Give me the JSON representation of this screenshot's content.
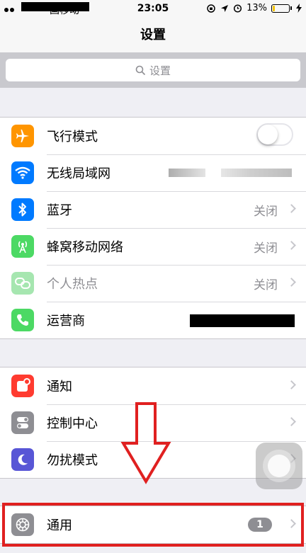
{
  "status_bar": {
    "carrier": "国移动",
    "time": "23:05",
    "battery_percent": "13%",
    "battery_level": 0.13
  },
  "nav": {
    "title": "设置"
  },
  "search": {
    "placeholder": "设置"
  },
  "group1": [
    {
      "label": "飞行模式",
      "icon": "airplane-icon",
      "color": "#ff9500",
      "toggle_on": false
    },
    {
      "label": "无线局域网",
      "icon": "wifi-icon",
      "color": "#007aff"
    },
    {
      "label": "蓝牙",
      "icon": "bluetooth-icon",
      "color": "#007aff",
      "value": "关闭"
    },
    {
      "label": "蜂窝移动网络",
      "icon": "cellular-icon",
      "color": "#4cd964",
      "value": "关闭"
    },
    {
      "label": "个人热点",
      "icon": "hotspot-icon",
      "color": "#a6e6b0",
      "value": "关闭",
      "disabled": true
    },
    {
      "label": "运营商",
      "icon": "phone-icon",
      "color": "#4cd964"
    }
  ],
  "group2": [
    {
      "label": "通知",
      "icon": "notification-icon",
      "color": "#ff3b30"
    },
    {
      "label": "控制中心",
      "icon": "control-center-icon",
      "color": "#8e8e93"
    },
    {
      "label": "勿扰模式",
      "icon": "moon-icon",
      "color": "#5856d6"
    }
  ],
  "group3": [
    {
      "label": "通用",
      "icon": "gear-icon",
      "color": "#8e8e93",
      "badge": "1"
    }
  ],
  "colors": {
    "annotation": "#e02020",
    "background": "#efeff4"
  }
}
